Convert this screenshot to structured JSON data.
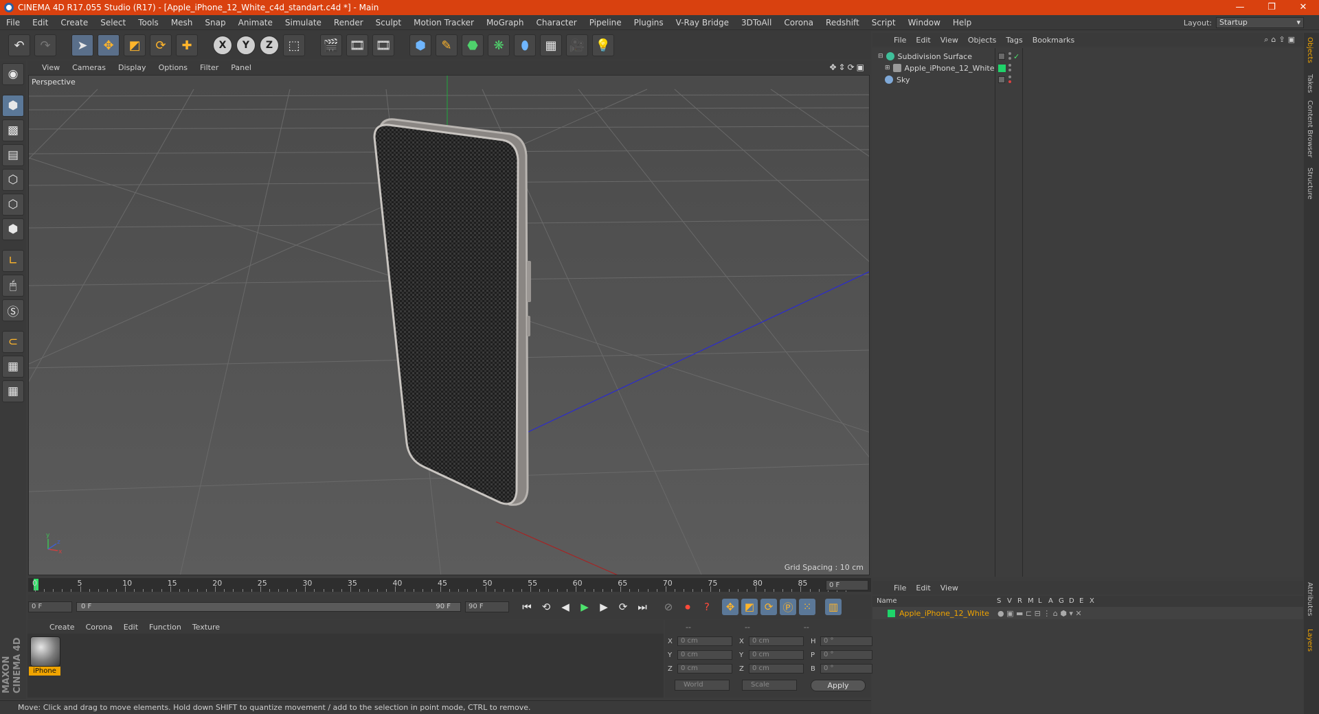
{
  "window": {
    "title": "CINEMA 4D R17.055 Studio (R17) - [Apple_iPhone_12_White_c4d_standart.c4d *] - Main"
  },
  "menubar": {
    "items": [
      "File",
      "Edit",
      "Create",
      "Select",
      "Tools",
      "Mesh",
      "Snap",
      "Animate",
      "Simulate",
      "Render",
      "Sculpt",
      "Motion Tracker",
      "MoGraph",
      "Character",
      "Pipeline",
      "Plugins",
      "V-Ray Bridge",
      "3DToAll",
      "Corona",
      "Redshift",
      "Script",
      "Window",
      "Help"
    ],
    "layout_label": "Layout:",
    "layout_value": "Startup"
  },
  "toolbar": {
    "x_label": "X",
    "y_label": "Y",
    "z_label": "Z"
  },
  "viewport": {
    "menu": [
      "View",
      "Cameras",
      "Display",
      "Options",
      "Filter",
      "Panel"
    ],
    "camera_label": "Perspective",
    "grid_spacing": "Grid Spacing : 10 cm"
  },
  "timeline": {
    "ticks": [
      "0",
      "5",
      "10",
      "15",
      "20",
      "25",
      "30",
      "35",
      "40",
      "45",
      "50",
      "55",
      "60",
      "65",
      "70",
      "75",
      "80",
      "85",
      "90"
    ],
    "current_frame": "0 F"
  },
  "transport": {
    "start_field": "0 F",
    "range_start": "0 F",
    "range_end": "90 F",
    "end_field": "90 F"
  },
  "material_manager": {
    "menu": [
      "Create",
      "Corona",
      "Edit",
      "Function",
      "Texture"
    ],
    "material_name": "iPhone"
  },
  "coordinates": {
    "headers": [
      "--",
      "--",
      "--"
    ],
    "rows": [
      {
        "a_label": "X",
        "a_value": "0 cm",
        "b_label": "X",
        "b_value": "0 cm",
        "c_label": "H",
        "c_value": "0 °"
      },
      {
        "a_label": "Y",
        "a_value": "0 cm",
        "b_label": "Y",
        "b_value": "0 cm",
        "c_label": "P",
        "c_value": "0 °"
      },
      {
        "a_label": "Z",
        "a_value": "0 cm",
        "b_label": "Z",
        "b_value": "0 cm",
        "c_label": "B",
        "c_value": "0 °"
      }
    ],
    "space_select": "World",
    "mode_select": "Scale",
    "apply_label": "Apply"
  },
  "status": {
    "text": "Move: Click and drag to move elements. Hold down SHIFT to quantize movement / add to the selection in point mode, CTRL to remove."
  },
  "object_manager": {
    "menu": [
      "File",
      "Edit",
      "View",
      "Objects",
      "Tags",
      "Bookmarks"
    ],
    "objects": [
      {
        "name": "Subdivision Surface",
        "icon_color": "#3fbf9a"
      },
      {
        "name": "Apple_iPhone_12_White",
        "icon_color": "#9a9a9a"
      },
      {
        "name": "Sky",
        "icon_color": "#7fa9d8"
      }
    ]
  },
  "layer_manager": {
    "menu": [
      "File",
      "Edit",
      "View"
    ],
    "columns": [
      "Name",
      "S",
      "V",
      "R",
      "M",
      "L",
      "A",
      "G",
      "D",
      "E",
      "X"
    ],
    "layer_name": "Apple_iPhone_12_White",
    "layer_color": "#1fd46a"
  },
  "right_tabs": [
    "Objects",
    "Takes",
    "Content Browser",
    "Structure",
    "Attributes",
    "Layers"
  ],
  "colors": {
    "title_bar": "#d9410f",
    "accent_orange": "#f0a400",
    "play_green": "#4de36d"
  }
}
